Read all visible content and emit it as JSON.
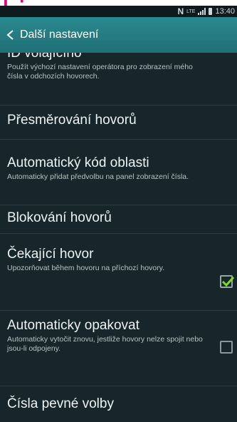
{
  "status_bar": {
    "network_icon": "nfc-icon",
    "lte_label": "LTE",
    "time": "13:40",
    "colors": {
      "bar": "#0e1a1d",
      "icons": "#cfd8d8"
    }
  },
  "header": {
    "back_icon": "chevron-left-icon",
    "title": "Další nastavení",
    "color": "#1f6f75"
  },
  "items": [
    {
      "title": "ID volajícího",
      "subtitle": "Použít výchozí nastavení operátora pro zobrazení mého čísla v odchozích hovorech."
    },
    {
      "title": "Přesměrování hovorů"
    },
    {
      "title": "Automatický kód oblasti",
      "subtitle": "Automaticky přidat předvolbu na panel zobrazení čísla."
    },
    {
      "title": "Blokování hovorů"
    },
    {
      "title": "Čekající hovor",
      "subtitle": "Upozorňovat během hovoru na příchozí hovory.",
      "checked": true
    },
    {
      "title": "Automaticky opakovat",
      "subtitle": "Automaticky vytočit znovu, jestliže hovory nelze spojit nebo jsou-li odpojeny.",
      "checked": false
    },
    {
      "title": "Čísla pevné volby"
    }
  ],
  "accent": "#7ddc1f"
}
